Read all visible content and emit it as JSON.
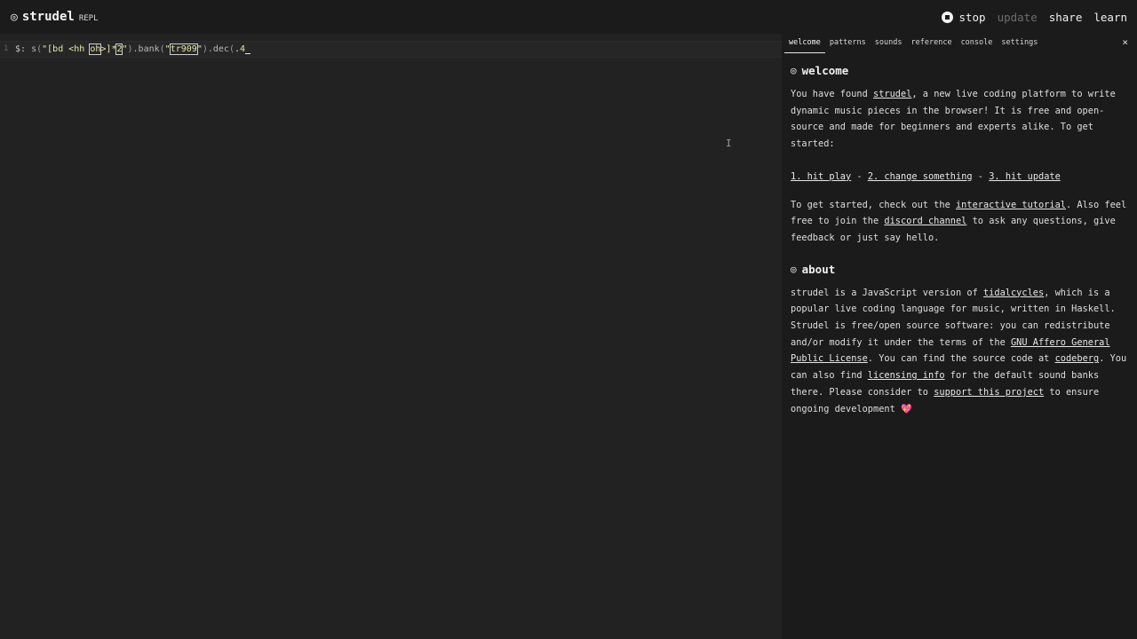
{
  "header": {
    "logo_icon": "spiral-icon",
    "title": "strudel",
    "subtitle": "REPL",
    "nav": {
      "stop": "stop",
      "update": "update",
      "share": "share",
      "learn": "learn"
    }
  },
  "editor": {
    "line_number": "1",
    "tokens": {
      "label": "$:",
      "fn_s": "s",
      "str1_a": "\"[bd <hh ",
      "str1_oh": "oh",
      "str1_b": ">]*",
      "str1_num": "2",
      "str1_c": "\"",
      "bank": ".bank",
      "str2_q1": "\"",
      "str2_val": "tr909",
      "str2_q2": "\"",
      "dec": ".dec",
      "dec_val": ".4"
    }
  },
  "panel": {
    "tabs": [
      "welcome",
      "patterns",
      "sounds",
      "reference",
      "console",
      "settings"
    ],
    "close": "×",
    "welcome": {
      "heading": "welcome",
      "p1_a": "You have found ",
      "p1_link": "strudel",
      "p1_b": ", a new live coding platform to write dynamic music pieces in the browser! It is free and open-source and made for beginners and experts alike. To get started:",
      "step1": "1. hit play",
      "sep": " - ",
      "step2": "2. change something",
      "step3": "3. hit update",
      "p3_a": "To get started, check out the ",
      "p3_link1": "interactive tutorial",
      "p3_b": ". Also feel free to join the ",
      "p3_link2": "discord channel",
      "p3_c": " to ask any questions, give feedback or just say hello."
    },
    "about": {
      "heading": "about",
      "a": "strudel is a JavaScript version of ",
      "link1": "tidalcycles",
      "b": ", which is a popular live coding language for music, written in Haskell. Strudel is free/open source software: you can redistribute and/or modify it under the terms of the ",
      "link2": "GNU Affero General Public License",
      "c": ". You can find the source code at ",
      "link3": "codeberg",
      "d": ". You can also find ",
      "link4": "licensing info",
      "e": " for the default sound banks there. Please consider to ",
      "link5": "support this project",
      "f": " to ensure ongoing development ",
      "heart": "💖"
    }
  }
}
